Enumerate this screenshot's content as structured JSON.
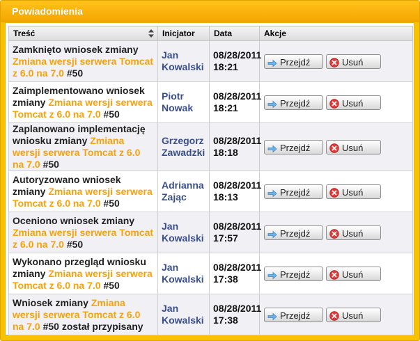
{
  "panel": {
    "title": "Powiadomienia"
  },
  "table": {
    "headers": {
      "content": "Treść",
      "initiator": "Inicjator",
      "date": "Data",
      "actions": "Akcje"
    },
    "go_label": "Przejdź",
    "delete_label": "Usuń",
    "rows": [
      {
        "text_before": "Zamknięto wniosek zmiany ",
        "link": "Zmiana wersji serwera Tomcat z 6.0 na 7.0",
        "text_after": " #50",
        "initiator": "Jan Kowalski",
        "date": "08/28/2011 18:21"
      },
      {
        "text_before": "Zaimplementowano wniosek zmiany ",
        "link": "Zmiana wersji serwera Tomcat z 6.0 na 7.0",
        "text_after": " #50",
        "initiator": "Piotr Nowak",
        "date": "08/28/2011 18:21"
      },
      {
        "text_before": "Zaplanowano implementację wniosku zmiany ",
        "link": "Zmiana wersji serwera Tomcat z 6.0 na 7.0",
        "text_after": " #50",
        "initiator": "Grzegorz Zawadzki",
        "date": "08/28/2011 18:18"
      },
      {
        "text_before": "Autoryzowano wniosek zmiany ",
        "link": "Zmiana wersji serwera Tomcat z 6.0 na 7.0",
        "text_after": " #50",
        "initiator": "Adrianna Zając",
        "date": "08/28/2011 18:13"
      },
      {
        "text_before": "Oceniono wniosek zmiany ",
        "link": "Zmiana wersji serwera Tomcat z 6.0 na 7.0",
        "text_after": " #50",
        "initiator": "Jan Kowalski",
        "date": "08/28/2011 17:57"
      },
      {
        "text_before": "Wykonano przegląd wniosku zmiany ",
        "link": "Zmiana wersji serwera Tomcat z 6.0 na 7.0",
        "text_after": " #50",
        "initiator": "Jan Kowalski",
        "date": "08/28/2011 17:38"
      },
      {
        "text_before": "Wniosek zmiany ",
        "link": "Zmiana wersji serwera Tomcat z 6.0 na 7.0",
        "text_after": " #50 został przypisany",
        "initiator": "Jan Kowalski",
        "date": "08/28/2011 17:38"
      }
    ]
  },
  "colors": {
    "header_orange": "#f4a600",
    "link_orange": "#f5a20c",
    "initiator_blue": "#3a4e8a",
    "row_alt": "#f0f0f5"
  },
  "icons": {
    "go": "arrow-right-icon",
    "delete": "delete-x-icon",
    "sort": "sort-arrows-icon"
  }
}
